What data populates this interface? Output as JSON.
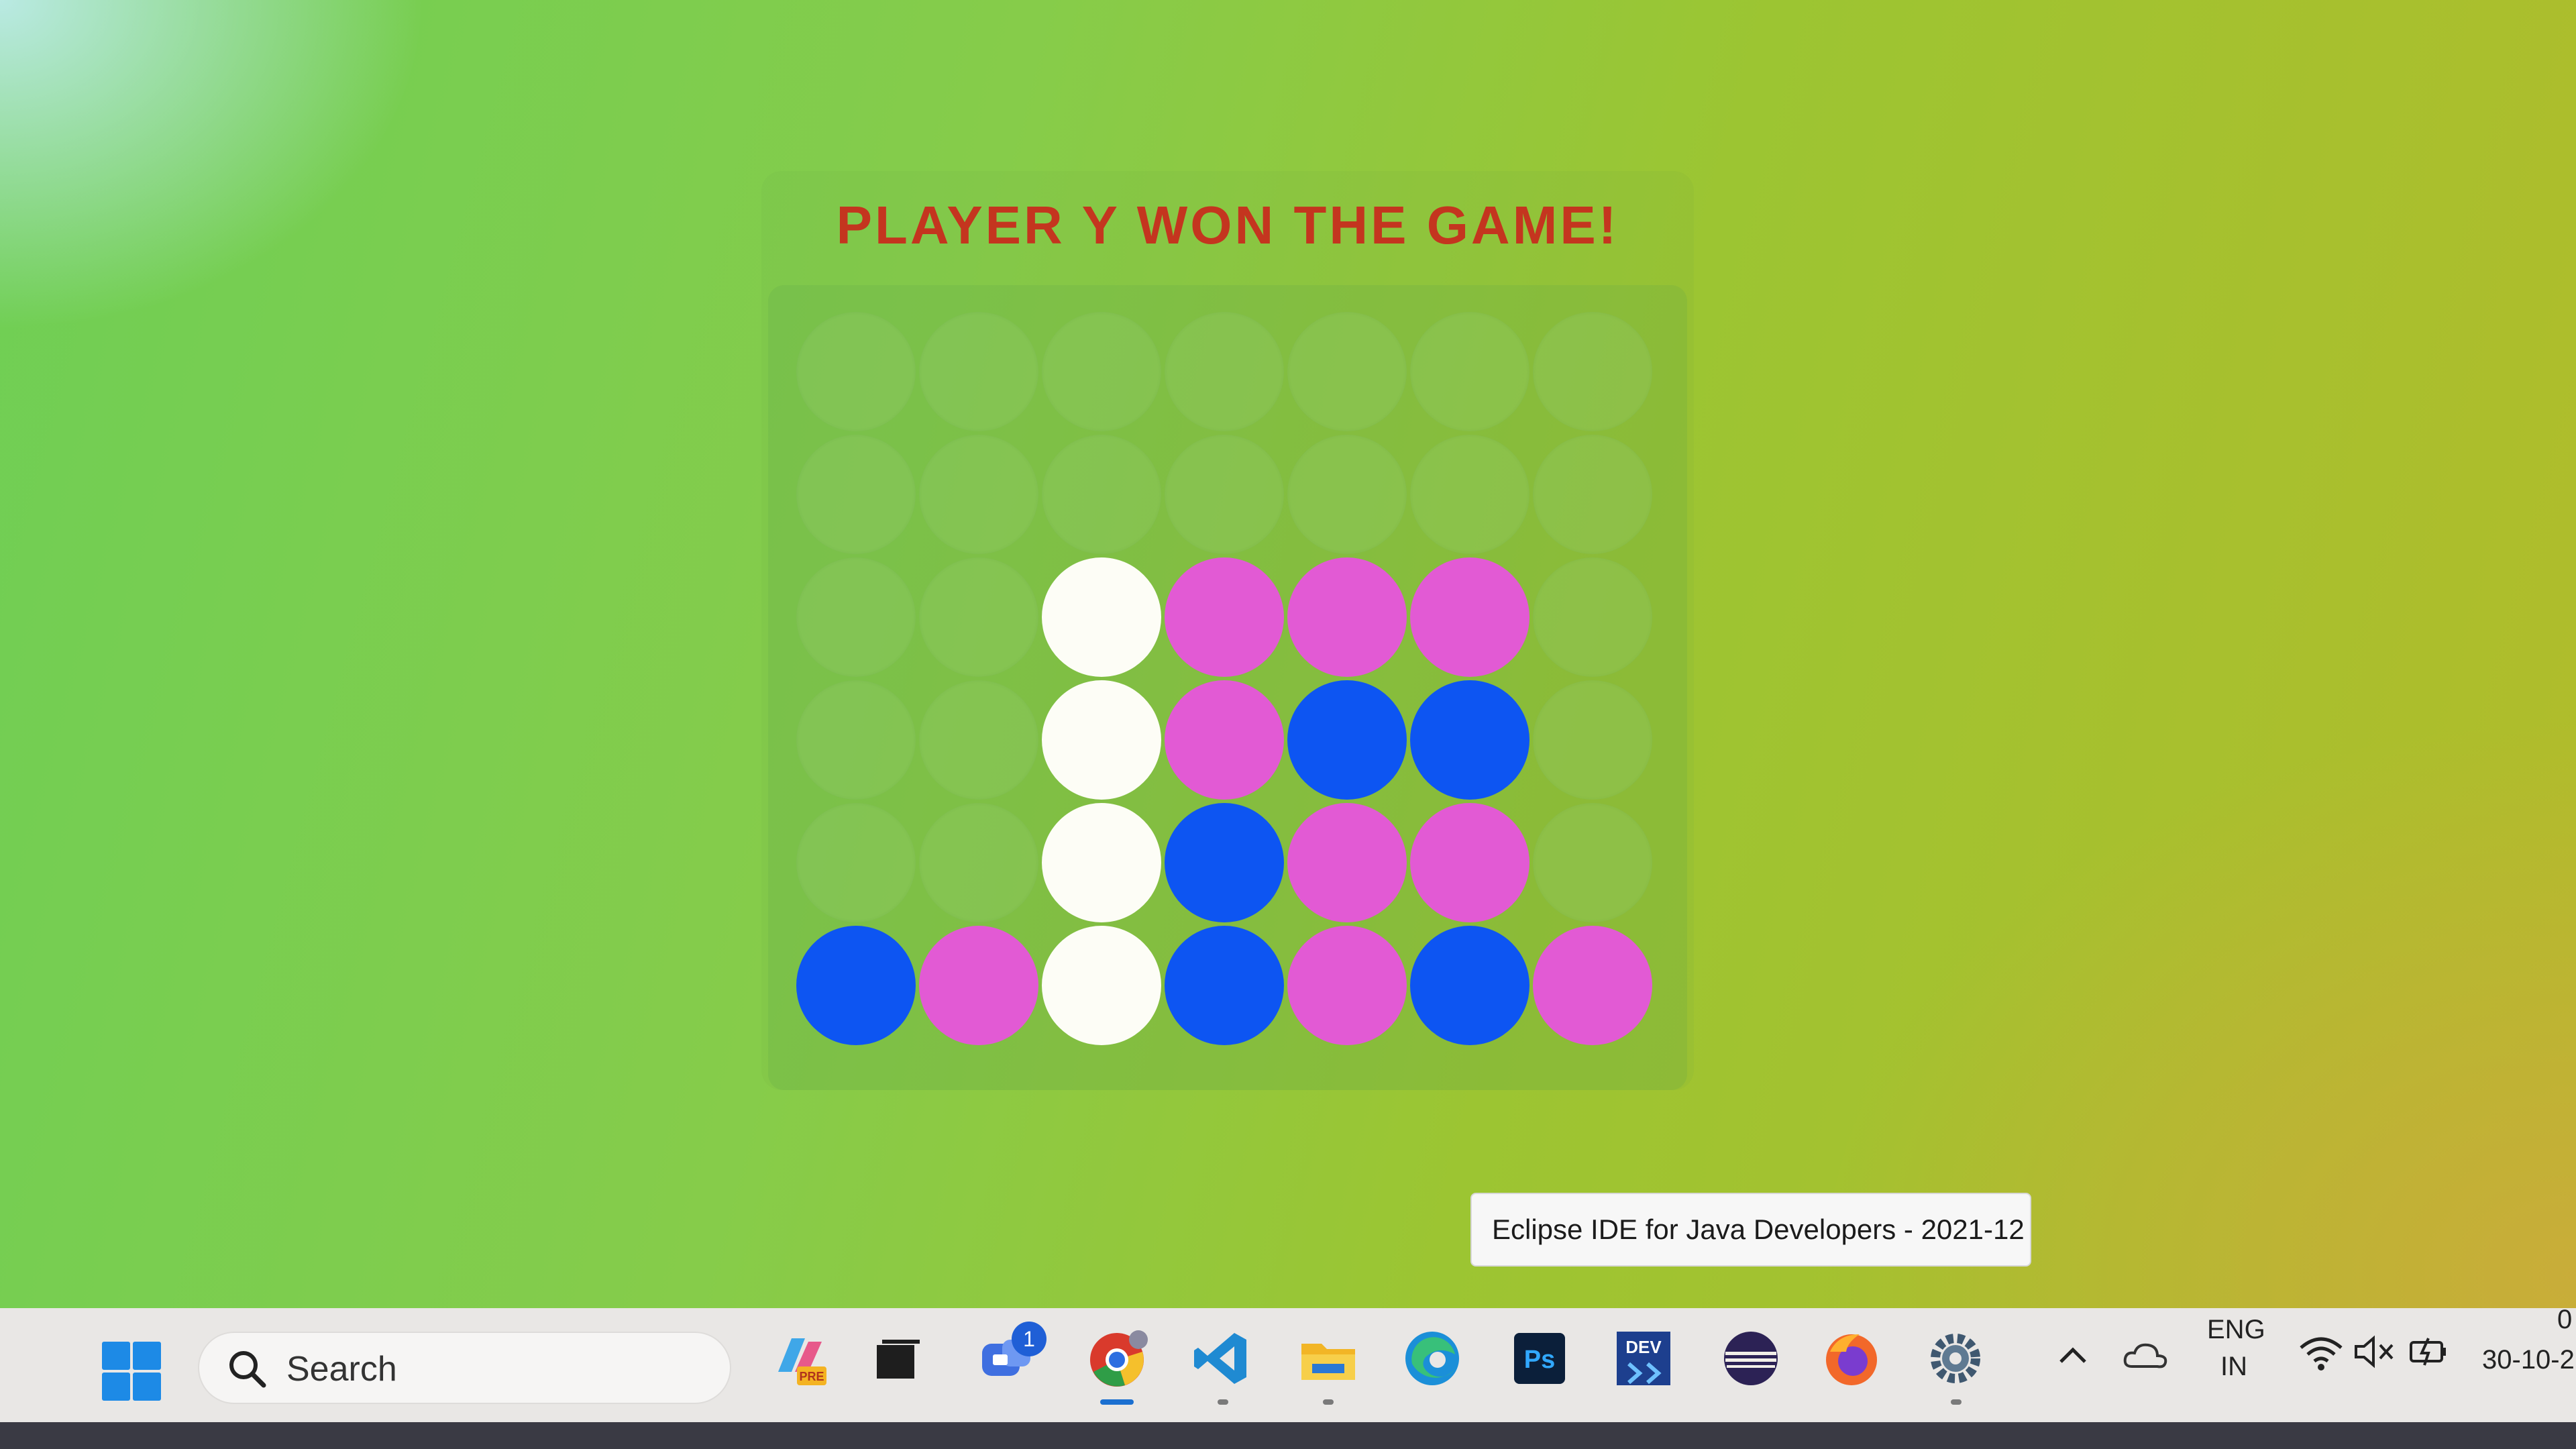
{
  "game": {
    "title": "PLAYER Y WON THE GAME!",
    "board": [
      [
        "empty",
        "empty",
        "empty",
        "empty",
        "empty",
        "empty",
        "empty"
      ],
      [
        "empty",
        "empty",
        "empty",
        "empty",
        "empty",
        "empty",
        "empty"
      ],
      [
        "empty",
        "empty",
        "white",
        "pink",
        "pink",
        "pink",
        "empty"
      ],
      [
        "empty",
        "empty",
        "white",
        "pink",
        "blue",
        "blue",
        "empty"
      ],
      [
        "empty",
        "empty",
        "white",
        "blue",
        "pink",
        "pink",
        "empty"
      ],
      [
        "blue",
        "pink",
        "white",
        "blue",
        "pink",
        "blue",
        "pink"
      ]
    ],
    "colors": {
      "white": "#fdfdf6",
      "pink": "#e25ad4",
      "blue": "#0d55f2",
      "title": "#c4351f"
    }
  },
  "tooltip": {
    "text": "Eclipse IDE for Java Developers - 2021-12"
  },
  "taskbar": {
    "search_label": "Search",
    "apps": [
      {
        "name": "copilot-icon"
      },
      {
        "name": "task-view-icon"
      },
      {
        "name": "teams-chat-icon",
        "badge": "1"
      },
      {
        "name": "chrome-icon"
      },
      {
        "name": "vscode-icon"
      },
      {
        "name": "file-explorer-icon"
      },
      {
        "name": "edge-icon"
      },
      {
        "name": "photoshop-icon",
        "label": "Ps"
      },
      {
        "name": "devcpp-icon",
        "label": "DEV"
      },
      {
        "name": "eclipse-icon"
      },
      {
        "name": "firefox-icon"
      },
      {
        "name": "settings-icon"
      }
    ],
    "tray": {
      "language": "ENG",
      "region": "IN",
      "time": "0",
      "date": "30-10-2"
    }
  }
}
